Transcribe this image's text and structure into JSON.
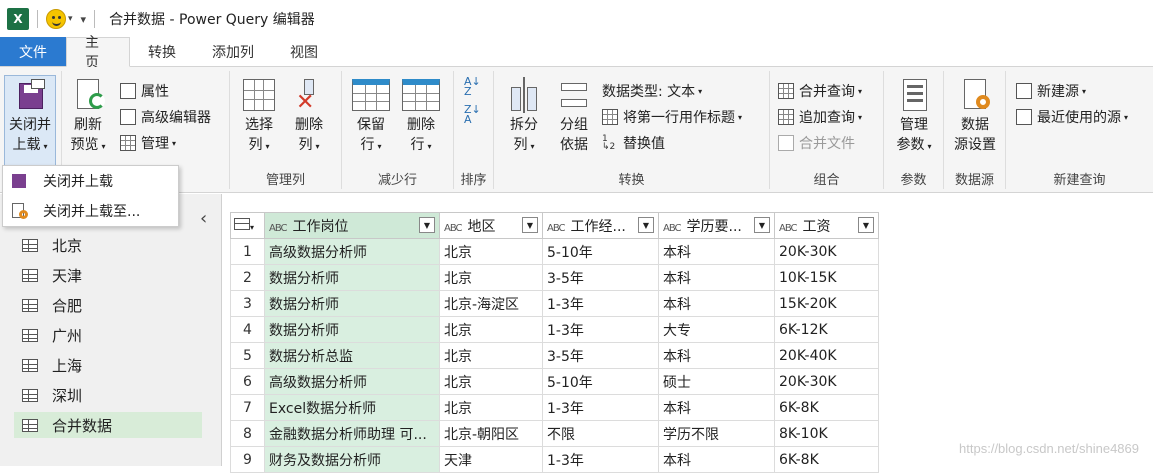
{
  "window": {
    "app_icon": "X",
    "title": "合并数据 - Power Query 编辑器"
  },
  "tabs": [
    {
      "label": "文件"
    },
    {
      "label": "主页"
    },
    {
      "label": "转换"
    },
    {
      "label": "添加列"
    },
    {
      "label": "视图"
    }
  ],
  "ribbon": {
    "close_load": {
      "line1": "关闭并",
      "line2": "上载"
    },
    "refresh": {
      "line1": "刷新",
      "line2": "预览"
    },
    "properties": "属性",
    "advanced_editor": "高级编辑器",
    "manage": "管理",
    "choose_cols": {
      "line1": "选择",
      "line2": "列"
    },
    "remove_cols": {
      "line1": "删除",
      "line2": "列"
    },
    "manage_cols_label": "管理列",
    "keep_rows": {
      "line1": "保留",
      "line2": "行"
    },
    "remove_rows": {
      "line1": "删除",
      "line2": "行"
    },
    "reduce_rows_label": "减少行",
    "sort_label": "排序",
    "split_col": {
      "line1": "拆分",
      "line2": "列"
    },
    "group_by": {
      "line1": "分组",
      "line2": "依据"
    },
    "data_type": "数据类型: 文本",
    "first_row_header": "将第一行用作标题",
    "replace_values": "替换值",
    "transform_label": "转换",
    "merge_queries": "合并查询",
    "append_queries": "追加查询",
    "combine_files": "合并文件",
    "combine_label": "组合",
    "manage_params": {
      "line1": "管理",
      "line2": "参数"
    },
    "params_label": "参数",
    "data_source_settings": {
      "line1": "数据",
      "line2": "源设置"
    },
    "datasource_label": "数据源",
    "new_source": "新建源",
    "recent_sources": "最近使用的源",
    "new_query_label": "新建查询"
  },
  "dropdown_menu": [
    {
      "label": "关闭并上载"
    },
    {
      "label": "关闭并上载至..."
    }
  ],
  "queries": [
    {
      "label": "北京"
    },
    {
      "label": "天津"
    },
    {
      "label": "合肥"
    },
    {
      "label": "广州"
    },
    {
      "label": "上海"
    },
    {
      "label": "深圳"
    },
    {
      "label": "合并数据"
    }
  ],
  "table": {
    "type_badge": "ABC",
    "headers": [
      "工作岗位",
      "地区",
      "工作经...",
      "学历要...",
      "工资"
    ],
    "rows": [
      [
        "1",
        "高级数据分析师",
        "北京",
        "5-10年",
        "本科",
        "20K-30K"
      ],
      [
        "2",
        "数据分析师",
        "北京",
        "3-5年",
        "本科",
        "10K-15K"
      ],
      [
        "3",
        "数据分析师",
        "北京-海淀区",
        "1-3年",
        "本科",
        "15K-20K"
      ],
      [
        "4",
        "数据分析师",
        "北京",
        "1-3年",
        "大专",
        "6K-12K"
      ],
      [
        "5",
        "数据分析总监",
        "北京",
        "3-5年",
        "本科",
        "20K-40K"
      ],
      [
        "6",
        "高级数据分析师",
        "北京",
        "5-10年",
        "硕士",
        "20K-30K"
      ],
      [
        "7",
        "Excel数据分析师",
        "北京",
        "1-3年",
        "本科",
        "6K-8K"
      ],
      [
        "8",
        "金融数据分析师助理 可...",
        "北京-朝阳区",
        "不限",
        "学历不限",
        "8K-10K"
      ],
      [
        "9",
        "财务及数据分析师",
        "天津",
        "1-3年",
        "本科",
        "6K-8K"
      ]
    ]
  },
  "watermark": "https://blog.csdn.net/shine4869"
}
